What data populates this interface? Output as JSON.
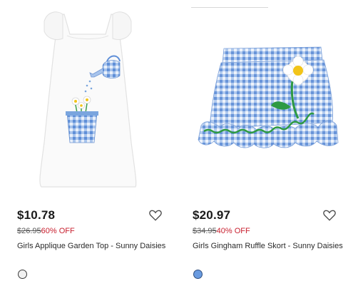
{
  "products": [
    {
      "price": "$10.78",
      "original_price": "$26.95",
      "discount": "60% OFF",
      "name": "Girls Applique Garden Top - Sunny Daisies",
      "swatch_color": "#f1f1f1",
      "wishlist_icon": "heart-outline-icon"
    },
    {
      "price": "$20.97",
      "original_price": "$34.95",
      "discount": "40% OFF",
      "name": "Girls Gingham Ruffle Skort - Sunny Daisies",
      "swatch_color": "#6a9be0",
      "wishlist_icon": "heart-outline-icon"
    }
  ],
  "colors": {
    "price": "#1a1a1a",
    "discount": "#c8202f",
    "gingham": "#7aa5de"
  }
}
